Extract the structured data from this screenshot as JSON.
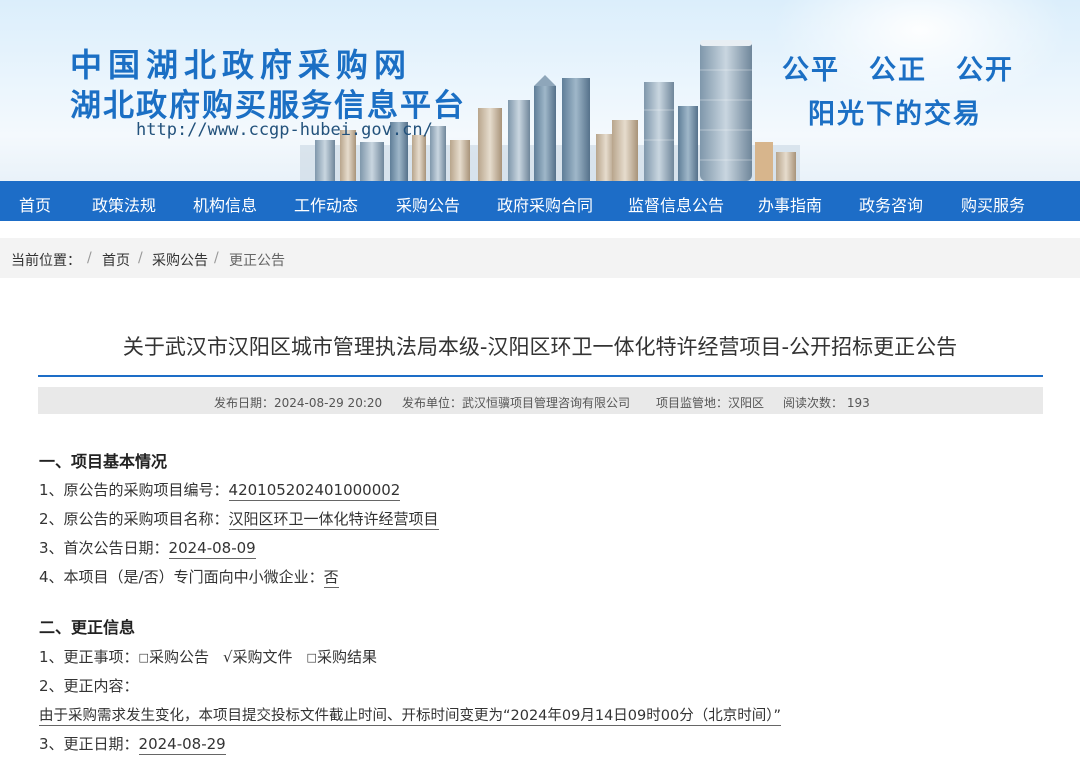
{
  "banner": {
    "title_line1": "中国湖北政府采购网",
    "title_line2": "湖北政府购买服务信息平台",
    "url": "http://www.ccgp-hubei.gov.cn/",
    "slogan_line1": "公平　公正　公开",
    "slogan_line2": "阳光下的交易"
  },
  "nav": {
    "items": [
      "首页",
      "政策法规",
      "机构信息",
      "工作动态",
      "采购公告",
      "政府采购合同",
      "监督信息公告",
      "办事指南",
      "政务咨询",
      "购买服务"
    ]
  },
  "breadcrumb": {
    "label": "当前位置：",
    "sep": "/",
    "items": [
      "首页",
      "采购公告",
      "更正公告"
    ]
  },
  "article": {
    "title": "关于武汉市汉阳区城市管理执法局本级-汉阳区环卫一体化特许经营项目-公开招标更正公告",
    "meta": {
      "publish_date": "发布日期：2024-08-29 20:20",
      "publisher": "发布单位：武汉恒骥项目管理咨询有限公司",
      "region": "项目监管地：汉阳区",
      "views": "阅读次数：  193"
    },
    "section1": {
      "heading": "一、项目基本情况",
      "items": [
        {
          "label": "1、原公告的采购项目编号：",
          "value": "420105202401000002"
        },
        {
          "label": "2、原公告的采购项目名称：",
          "value": "汉阳区环卫一体化特许经营项目"
        },
        {
          "label": "3、首次公告日期：",
          "value": "2024-08-09"
        },
        {
          "label": "4、本项目（是/否）专门面向中小微企业：",
          "value": "否"
        }
      ]
    },
    "section2": {
      "heading": "二、更正信息",
      "item1_label": "1、更正事项：",
      "options": [
        {
          "mark": "□",
          "label": "采购公告"
        },
        {
          "mark": "√",
          "label": "采购文件"
        },
        {
          "mark": "□",
          "label": "采购结果"
        }
      ],
      "item2_label": "2、更正内容：",
      "content": "由于采购需求发生变化，本项目提交投标文件截止时间、开标时间变更为“2024年09月14日09时00分（北京时间）”",
      "item3_label": "3、更正日期：",
      "item3_value": "2024-08-29"
    }
  }
}
